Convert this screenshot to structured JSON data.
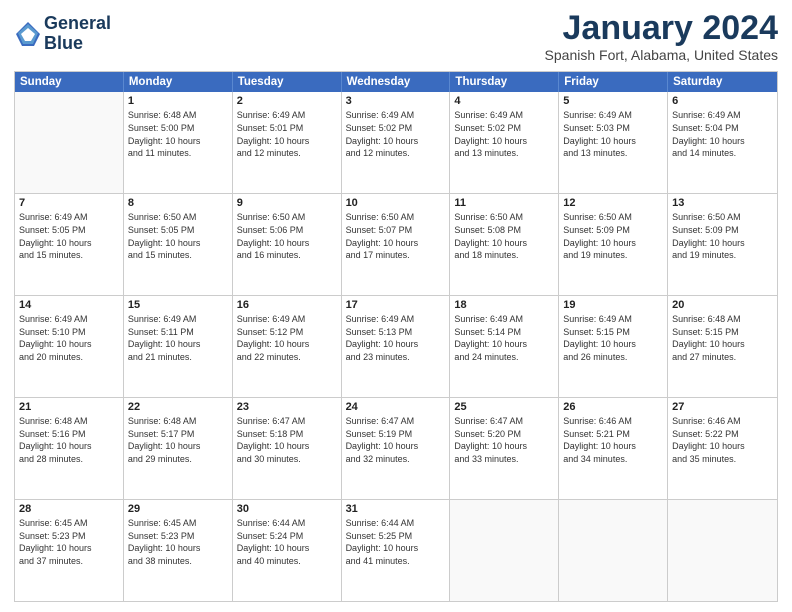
{
  "logo": {
    "line1": "General",
    "line2": "Blue"
  },
  "title": "January 2024",
  "location": "Spanish Fort, Alabama, United States",
  "headers": [
    "Sunday",
    "Monday",
    "Tuesday",
    "Wednesday",
    "Thursday",
    "Friday",
    "Saturday"
  ],
  "weeks": [
    [
      {
        "day": "",
        "lines": []
      },
      {
        "day": "1",
        "lines": [
          "Sunrise: 6:48 AM",
          "Sunset: 5:00 PM",
          "Daylight: 10 hours",
          "and 11 minutes."
        ]
      },
      {
        "day": "2",
        "lines": [
          "Sunrise: 6:49 AM",
          "Sunset: 5:01 PM",
          "Daylight: 10 hours",
          "and 12 minutes."
        ]
      },
      {
        "day": "3",
        "lines": [
          "Sunrise: 6:49 AM",
          "Sunset: 5:02 PM",
          "Daylight: 10 hours",
          "and 12 minutes."
        ]
      },
      {
        "day": "4",
        "lines": [
          "Sunrise: 6:49 AM",
          "Sunset: 5:02 PM",
          "Daylight: 10 hours",
          "and 13 minutes."
        ]
      },
      {
        "day": "5",
        "lines": [
          "Sunrise: 6:49 AM",
          "Sunset: 5:03 PM",
          "Daylight: 10 hours",
          "and 13 minutes."
        ]
      },
      {
        "day": "6",
        "lines": [
          "Sunrise: 6:49 AM",
          "Sunset: 5:04 PM",
          "Daylight: 10 hours",
          "and 14 minutes."
        ]
      }
    ],
    [
      {
        "day": "7",
        "lines": [
          "Sunrise: 6:49 AM",
          "Sunset: 5:05 PM",
          "Daylight: 10 hours",
          "and 15 minutes."
        ]
      },
      {
        "day": "8",
        "lines": [
          "Sunrise: 6:50 AM",
          "Sunset: 5:05 PM",
          "Daylight: 10 hours",
          "and 15 minutes."
        ]
      },
      {
        "day": "9",
        "lines": [
          "Sunrise: 6:50 AM",
          "Sunset: 5:06 PM",
          "Daylight: 10 hours",
          "and 16 minutes."
        ]
      },
      {
        "day": "10",
        "lines": [
          "Sunrise: 6:50 AM",
          "Sunset: 5:07 PM",
          "Daylight: 10 hours",
          "and 17 minutes."
        ]
      },
      {
        "day": "11",
        "lines": [
          "Sunrise: 6:50 AM",
          "Sunset: 5:08 PM",
          "Daylight: 10 hours",
          "and 18 minutes."
        ]
      },
      {
        "day": "12",
        "lines": [
          "Sunrise: 6:50 AM",
          "Sunset: 5:09 PM",
          "Daylight: 10 hours",
          "and 19 minutes."
        ]
      },
      {
        "day": "13",
        "lines": [
          "Sunrise: 6:50 AM",
          "Sunset: 5:09 PM",
          "Daylight: 10 hours",
          "and 19 minutes."
        ]
      }
    ],
    [
      {
        "day": "14",
        "lines": [
          "Sunrise: 6:49 AM",
          "Sunset: 5:10 PM",
          "Daylight: 10 hours",
          "and 20 minutes."
        ]
      },
      {
        "day": "15",
        "lines": [
          "Sunrise: 6:49 AM",
          "Sunset: 5:11 PM",
          "Daylight: 10 hours",
          "and 21 minutes."
        ]
      },
      {
        "day": "16",
        "lines": [
          "Sunrise: 6:49 AM",
          "Sunset: 5:12 PM",
          "Daylight: 10 hours",
          "and 22 minutes."
        ]
      },
      {
        "day": "17",
        "lines": [
          "Sunrise: 6:49 AM",
          "Sunset: 5:13 PM",
          "Daylight: 10 hours",
          "and 23 minutes."
        ]
      },
      {
        "day": "18",
        "lines": [
          "Sunrise: 6:49 AM",
          "Sunset: 5:14 PM",
          "Daylight: 10 hours",
          "and 24 minutes."
        ]
      },
      {
        "day": "19",
        "lines": [
          "Sunrise: 6:49 AM",
          "Sunset: 5:15 PM",
          "Daylight: 10 hours",
          "and 26 minutes."
        ]
      },
      {
        "day": "20",
        "lines": [
          "Sunrise: 6:48 AM",
          "Sunset: 5:15 PM",
          "Daylight: 10 hours",
          "and 27 minutes."
        ]
      }
    ],
    [
      {
        "day": "21",
        "lines": [
          "Sunrise: 6:48 AM",
          "Sunset: 5:16 PM",
          "Daylight: 10 hours",
          "and 28 minutes."
        ]
      },
      {
        "day": "22",
        "lines": [
          "Sunrise: 6:48 AM",
          "Sunset: 5:17 PM",
          "Daylight: 10 hours",
          "and 29 minutes."
        ]
      },
      {
        "day": "23",
        "lines": [
          "Sunrise: 6:47 AM",
          "Sunset: 5:18 PM",
          "Daylight: 10 hours",
          "and 30 minutes."
        ]
      },
      {
        "day": "24",
        "lines": [
          "Sunrise: 6:47 AM",
          "Sunset: 5:19 PM",
          "Daylight: 10 hours",
          "and 32 minutes."
        ]
      },
      {
        "day": "25",
        "lines": [
          "Sunrise: 6:47 AM",
          "Sunset: 5:20 PM",
          "Daylight: 10 hours",
          "and 33 minutes."
        ]
      },
      {
        "day": "26",
        "lines": [
          "Sunrise: 6:46 AM",
          "Sunset: 5:21 PM",
          "Daylight: 10 hours",
          "and 34 minutes."
        ]
      },
      {
        "day": "27",
        "lines": [
          "Sunrise: 6:46 AM",
          "Sunset: 5:22 PM",
          "Daylight: 10 hours",
          "and 35 minutes."
        ]
      }
    ],
    [
      {
        "day": "28",
        "lines": [
          "Sunrise: 6:45 AM",
          "Sunset: 5:23 PM",
          "Daylight: 10 hours",
          "and 37 minutes."
        ]
      },
      {
        "day": "29",
        "lines": [
          "Sunrise: 6:45 AM",
          "Sunset: 5:23 PM",
          "Daylight: 10 hours",
          "and 38 minutes."
        ]
      },
      {
        "day": "30",
        "lines": [
          "Sunrise: 6:44 AM",
          "Sunset: 5:24 PM",
          "Daylight: 10 hours",
          "and 40 minutes."
        ]
      },
      {
        "day": "31",
        "lines": [
          "Sunrise: 6:44 AM",
          "Sunset: 5:25 PM",
          "Daylight: 10 hours",
          "and 41 minutes."
        ]
      },
      {
        "day": "",
        "lines": []
      },
      {
        "day": "",
        "lines": []
      },
      {
        "day": "",
        "lines": []
      }
    ]
  ]
}
